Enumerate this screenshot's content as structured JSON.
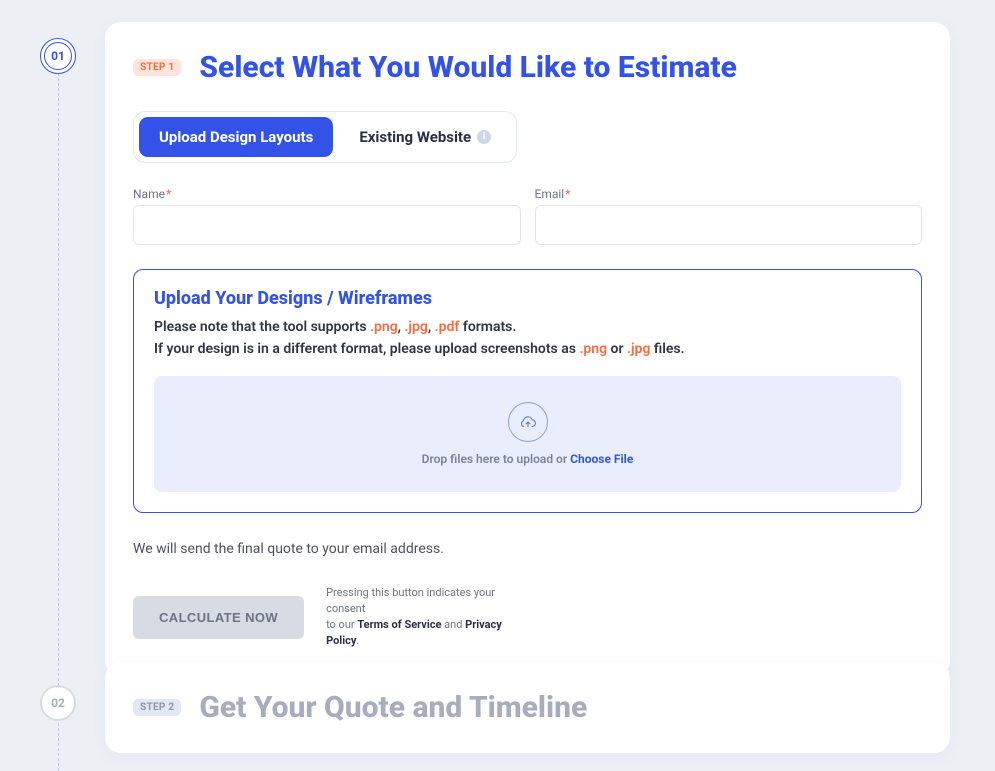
{
  "steps": {
    "s1_num": "01",
    "s2_num": "02",
    "s1_badge": "STEP 1",
    "s2_badge": "STEP 2",
    "s1_title": "Select What You Would Like to Estimate",
    "s2_title": "Get Your Quote and Timeline"
  },
  "tabs": {
    "upload": "Upload Design Layouts",
    "existing": "Existing Website"
  },
  "form": {
    "name_label": "Name",
    "email_label": "Email"
  },
  "upload_panel": {
    "title": "Upload Your Designs / Wireframes",
    "note_prefix": "Please note that the tool supports ",
    "ext_png": ".png",
    "sep1": ", ",
    "ext_jpg": ".jpg",
    "sep2": ", ",
    "ext_pdf": ".pdf",
    "note_suffix": " formats.",
    "line2_prefix": "If your design is in a different format, please upload screenshots as ",
    "line2_or": " or ",
    "line2_suffix": " files."
  },
  "dropzone": {
    "drop_text": "Drop files here to upload or ",
    "choose": "Choose File"
  },
  "final_note": "We will send the final quote to your email address.",
  "button": {
    "calculate": "CALCULATE NOW"
  },
  "consent": {
    "line1": "Pressing this button indicates your consent",
    "line2_prefix": "to our ",
    "tos": "Terms of Service",
    "and": " and ",
    "pp": "Privacy Policy",
    "dot": "."
  }
}
